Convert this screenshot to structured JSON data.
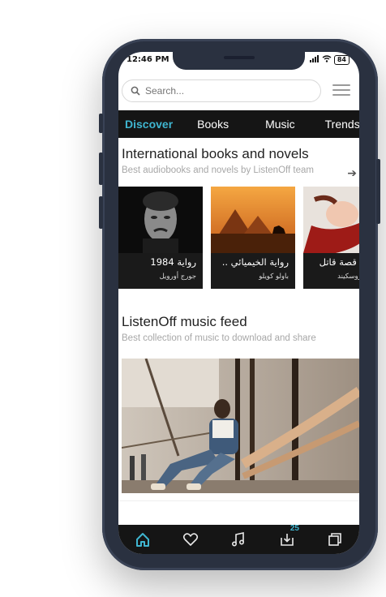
{
  "status_bar": {
    "time": "12:46 PM",
    "battery": "84"
  },
  "search": {
    "placeholder": "Search..."
  },
  "tabs": [
    {
      "label": "Discover",
      "active": true
    },
    {
      "label": "Books",
      "active": false
    },
    {
      "label": "Music",
      "active": false
    },
    {
      "label": "Trends",
      "active": false
    }
  ],
  "books_section": {
    "title": "International books and novels",
    "subtitle": "Best audiobooks and novels by ListenOff team",
    "items": [
      {
        "title": "رواية 1984",
        "author": "جورج أورويل"
      },
      {
        "title": "رواية الخيميائي ..",
        "author": "باولو كويلو"
      },
      {
        "title": "عطر: قصة قاتل",
        "author": "باتريك زوسكيند"
      }
    ]
  },
  "music_section": {
    "title": "ListenOff music feed",
    "subtitle": "Best collection of music to download and share"
  },
  "bottom_nav": {
    "items": [
      "home-icon",
      "heart-icon",
      "music-icon",
      "download-icon",
      "copy-icon"
    ],
    "download_badge": "25",
    "active_color": "#3fb5d0"
  },
  "colors": {
    "accent": "#3fb5d0",
    "phone_frame": "#2a3140",
    "tab_bar": "#151515"
  }
}
